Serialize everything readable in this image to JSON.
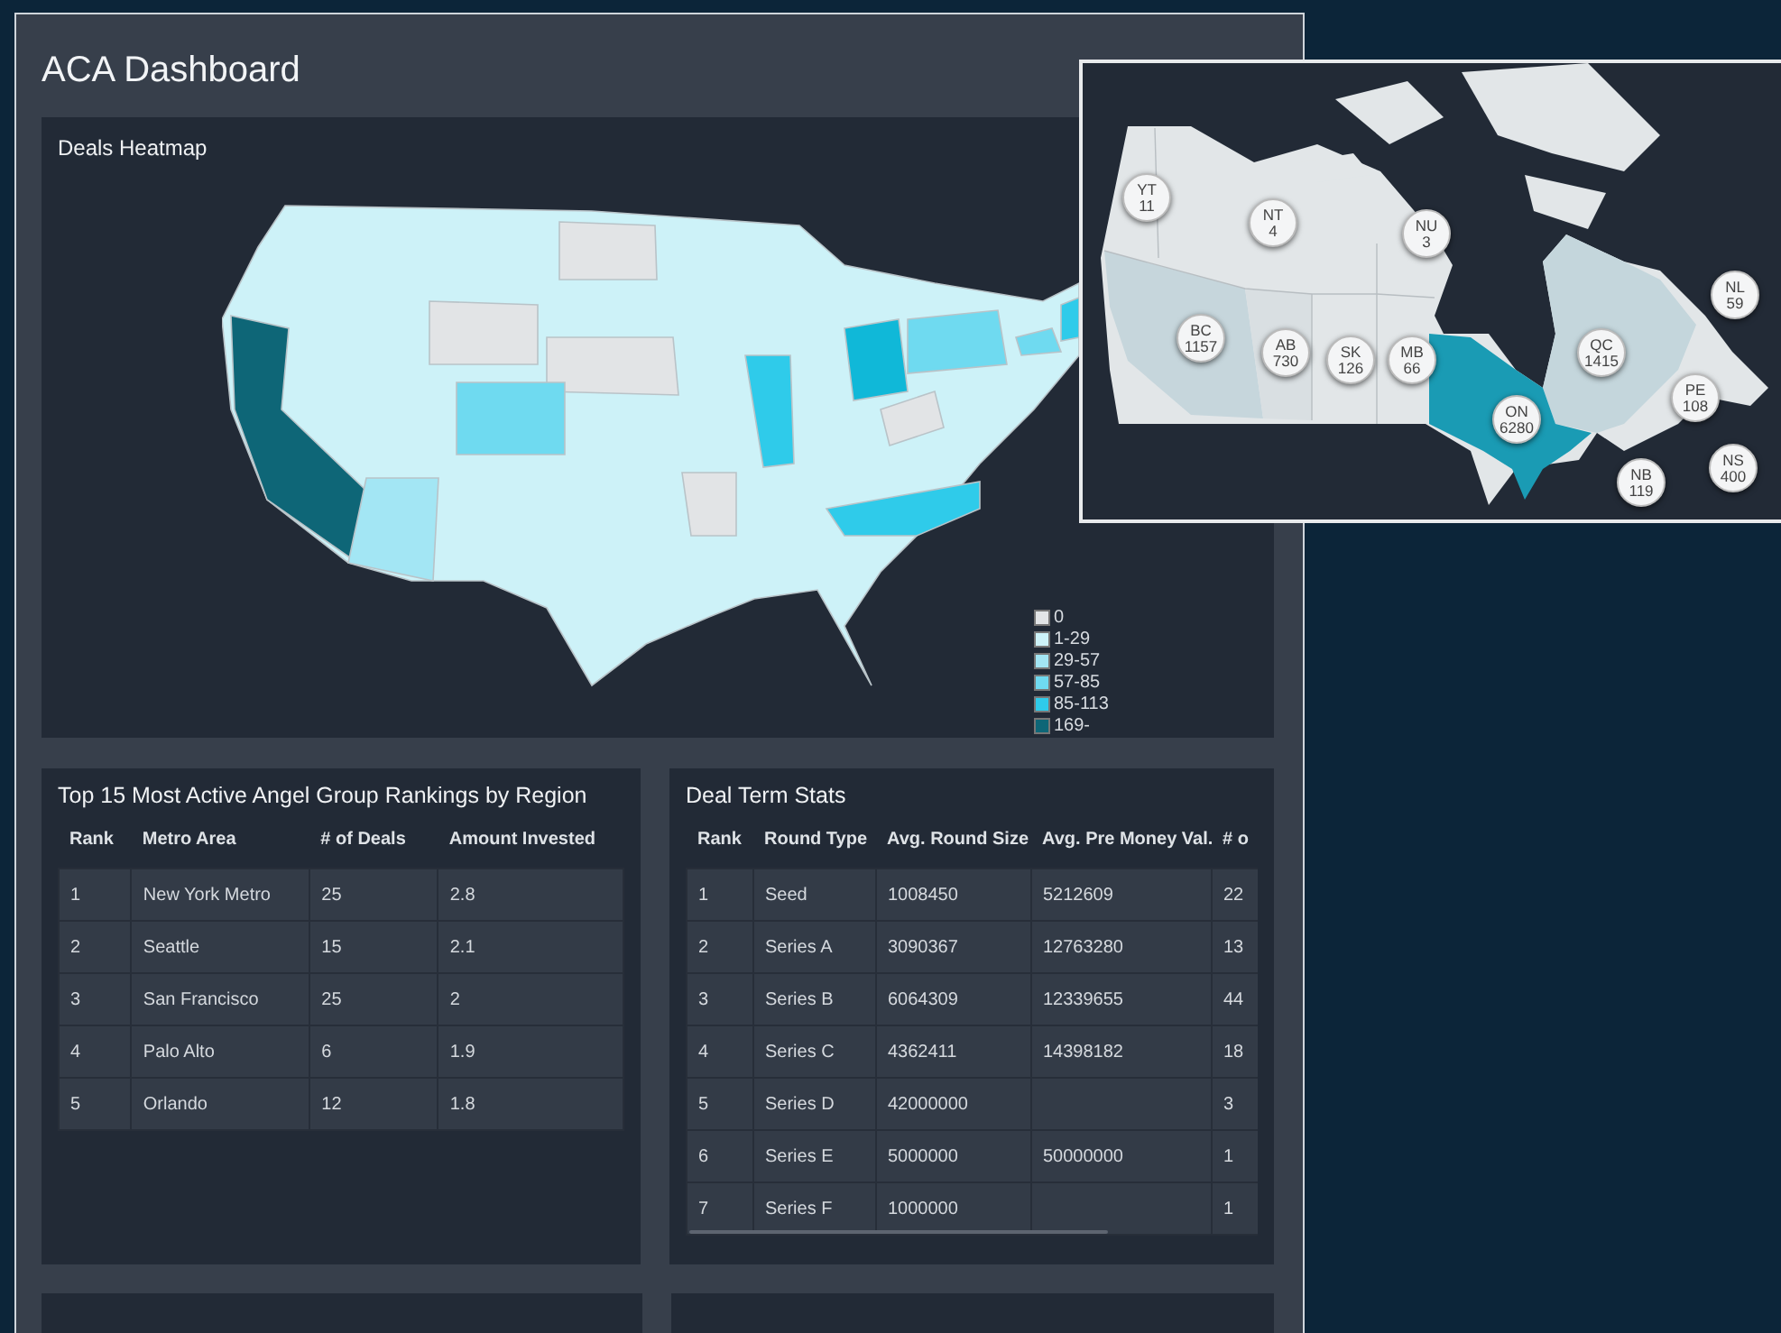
{
  "title": "ACA Dashboard",
  "heatmap": {
    "title": "Deals Heatmap",
    "legend": [
      {
        "label": "0",
        "color": "#e2e4e6"
      },
      {
        "label": "1-29",
        "color": "#cdf2f8"
      },
      {
        "label": "29-57",
        "color": "#a3e6f4"
      },
      {
        "label": "57-85",
        "color": "#6fdaf0"
      },
      {
        "label": "85-113",
        "color": "#2fcbea"
      },
      {
        "label": "169-",
        "color": "#0e6677"
      }
    ]
  },
  "rankings": {
    "title": "Top 15 Most Active Angel Group Rankings by Region",
    "columns": [
      "Rank",
      "Metro Area",
      "# of Deals",
      "Amount Invested"
    ],
    "rows": [
      [
        "1",
        "New York Metro",
        "25",
        "2.8"
      ],
      [
        "2",
        "Seattle",
        "15",
        "2.1"
      ],
      [
        "3",
        "San Francisco",
        "25",
        "2"
      ],
      [
        "4",
        "Palo Alto",
        "6",
        "1.9"
      ],
      [
        "5",
        "Orlando",
        "12",
        "1.8"
      ]
    ]
  },
  "deal_terms": {
    "title": "Deal Term Stats",
    "columns": [
      "Rank",
      "Round Type",
      "Avg. Round Size",
      "Avg. Pre Money Val.",
      "# o"
    ],
    "rows": [
      [
        "1",
        "Seed",
        "1008450",
        "5212609",
        "22"
      ],
      [
        "2",
        "Series A",
        "3090367",
        "12763280",
        "13"
      ],
      [
        "3",
        "Series B",
        "6064309",
        "12339655",
        "44"
      ],
      [
        "4",
        "Series C",
        "4362411",
        "14398182",
        "18"
      ],
      [
        "5",
        "Series D",
        "42000000",
        "",
        "3"
      ],
      [
        "6",
        "Series E",
        "5000000",
        "50000000",
        "1"
      ],
      [
        "7",
        "Series F",
        "1000000",
        "",
        "1"
      ]
    ]
  },
  "canada_map": {
    "provinces": [
      {
        "code": "YT",
        "value": "11"
      },
      {
        "code": "NT",
        "value": "4"
      },
      {
        "code": "NU",
        "value": "3"
      },
      {
        "code": "BC",
        "value": "1157"
      },
      {
        "code": "AB",
        "value": "730"
      },
      {
        "code": "SK",
        "value": "126"
      },
      {
        "code": "MB",
        "value": "66"
      },
      {
        "code": "ON",
        "value": "6280"
      },
      {
        "code": "QC",
        "value": "1415"
      },
      {
        "code": "NL",
        "value": "59"
      },
      {
        "code": "PE",
        "value": "108"
      },
      {
        "code": "NB",
        "value": "119"
      },
      {
        "code": "NS",
        "value": "400"
      }
    ]
  }
}
